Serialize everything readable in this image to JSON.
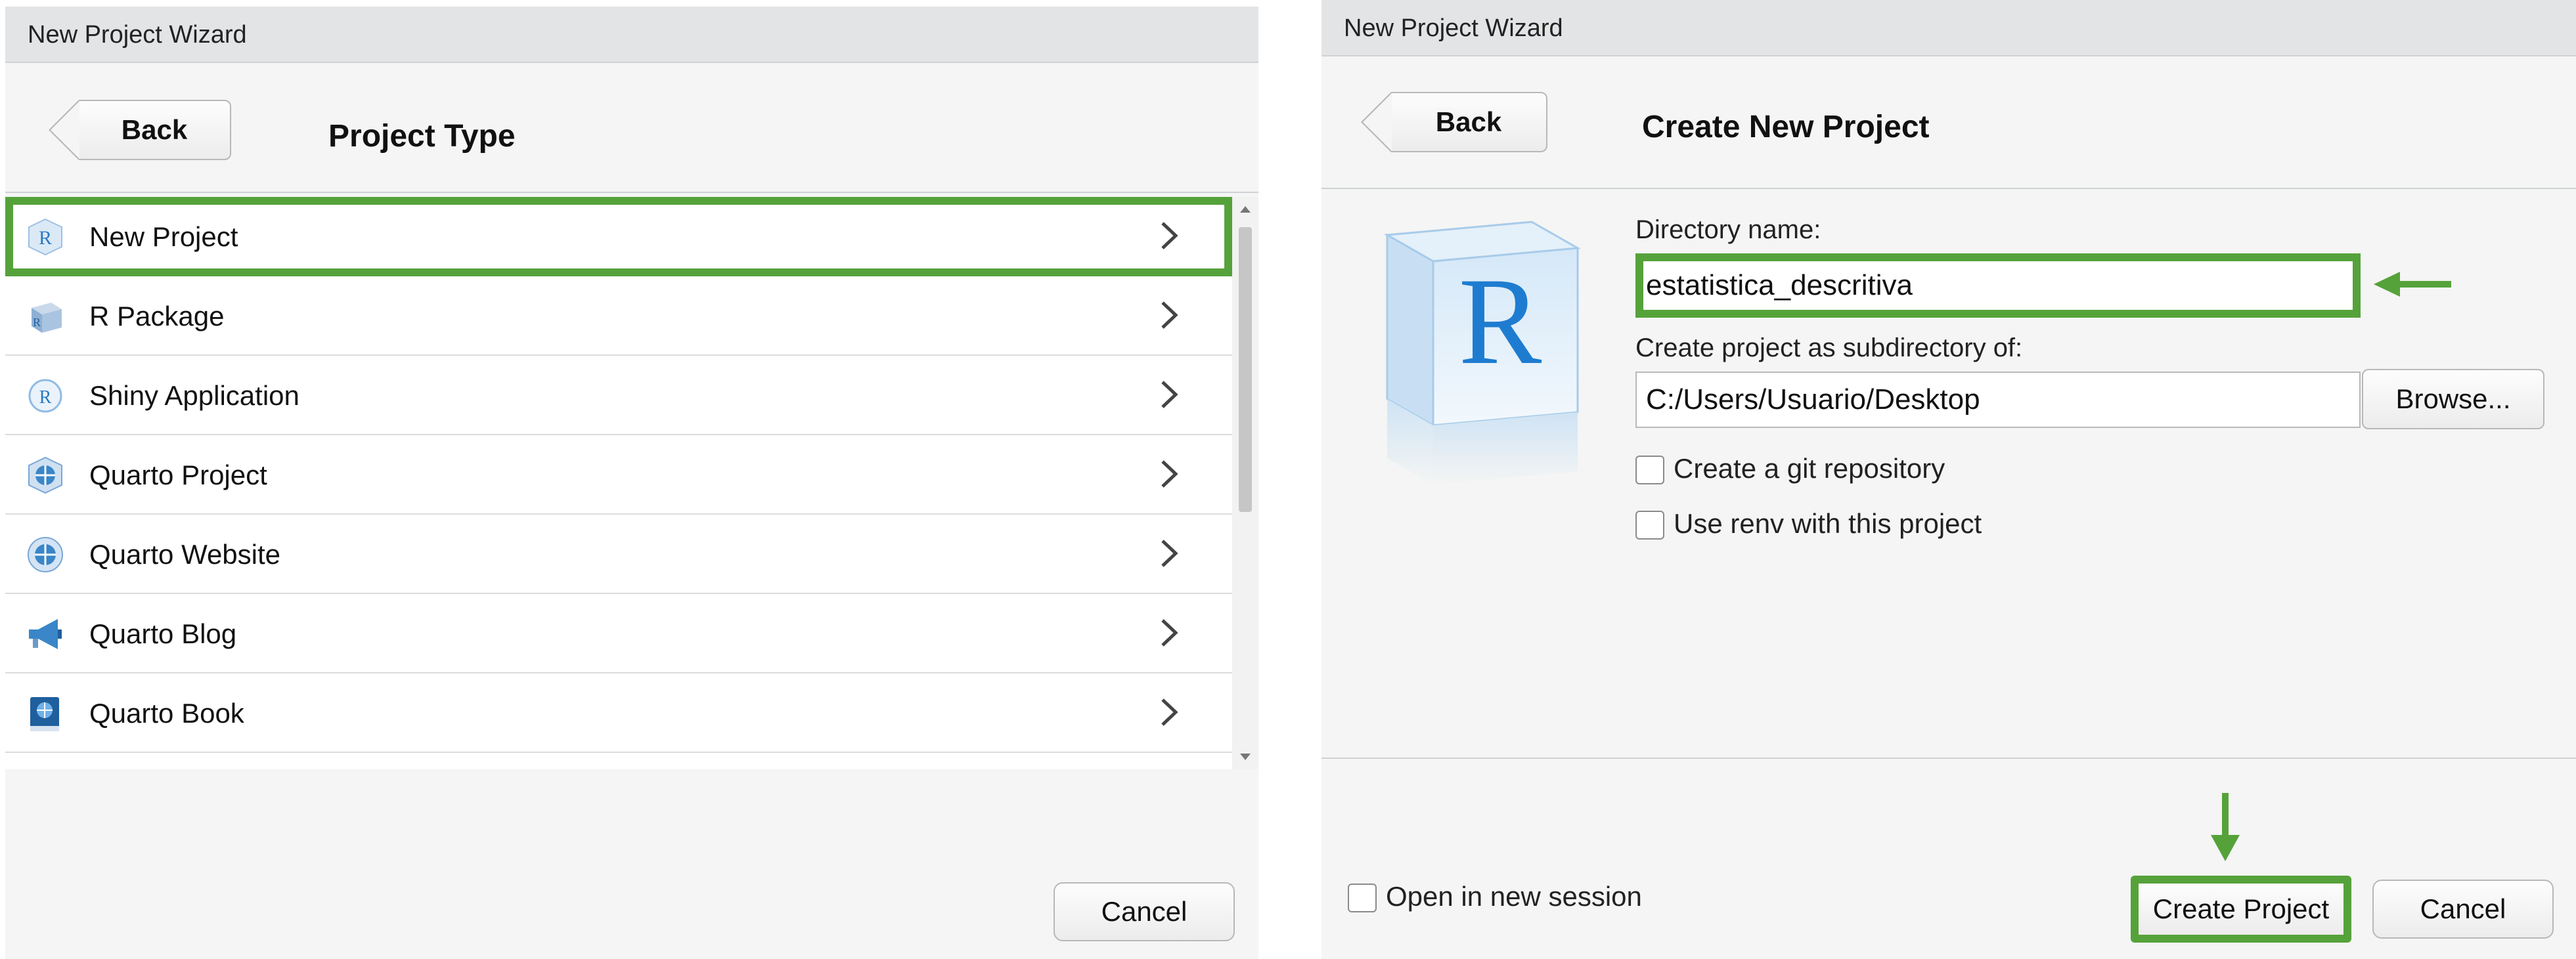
{
  "left_dialog": {
    "title": "New Project Wizard",
    "back_label": "Back",
    "heading": "Project Type",
    "items": [
      {
        "label": "New Project",
        "icon": "r-cube-icon"
      },
      {
        "label": "R Package",
        "icon": "r-package-icon"
      },
      {
        "label": "Shiny Application",
        "icon": "shiny-icon"
      },
      {
        "label": "Quarto Project",
        "icon": "quarto-globe-icon"
      },
      {
        "label": "Quarto Website",
        "icon": "quarto-website-icon"
      },
      {
        "label": "Quarto Blog",
        "icon": "megaphone-icon"
      },
      {
        "label": "Quarto Book",
        "icon": "book-icon"
      }
    ],
    "selected_item": "New Project",
    "cancel_label": "Cancel"
  },
  "right_dialog": {
    "title": "New Project Wizard",
    "back_label": "Back",
    "heading": "Create New Project",
    "logo_letter": "R",
    "directory_label": "Directory name:",
    "directory_value": "estatistica_descritiva",
    "subdir_label": "Create project as subdirectory of:",
    "subdir_value": "C:/Users/Usuario/Desktop",
    "browse_label": "Browse...",
    "git_label": "Create a git repository",
    "git_checked": false,
    "renv_label": "Use renv with this project",
    "renv_checked": false,
    "new_session_label": "Open in new session",
    "new_session_checked": false,
    "create_label": "Create Project",
    "cancel_label": "Cancel"
  },
  "colors": {
    "highlight": "#55a23a",
    "dialog_bg": "#f4f5f4",
    "titlebar_bg": "#e3e4e5"
  }
}
